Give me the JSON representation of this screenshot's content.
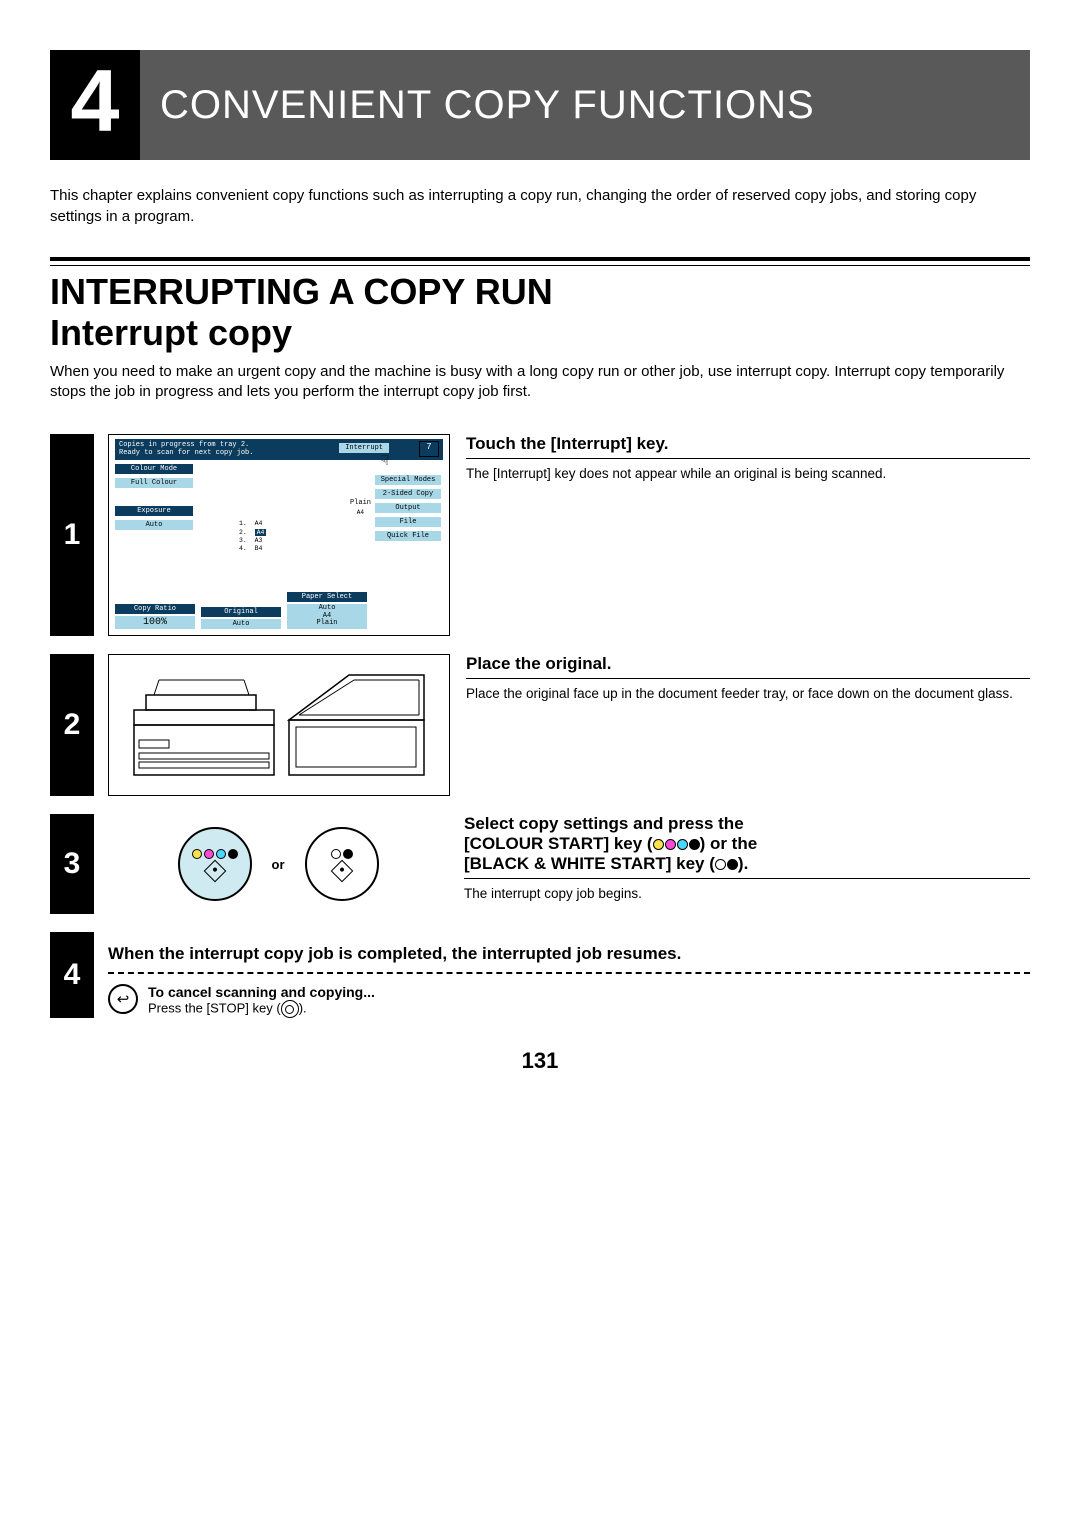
{
  "chapter": {
    "number": "4",
    "title": "CONVENIENT COPY FUNCTIONS"
  },
  "intro": "This chapter explains convenient copy functions such as interrupting a copy run, changing the order of reserved copy jobs, and storing copy settings in a program.",
  "section": {
    "title": "INTERRUPTING A COPY RUN",
    "subtitle": "Interrupt copy",
    "desc": "When you need to make an urgent copy and the machine is busy with a long copy run or other job, use interrupt copy. Interrupt copy temporarily stops the job in progress and lets you perform the interrupt copy job first."
  },
  "steps": {
    "s1": {
      "num": "1",
      "heading": "Touch the [Interrupt] key.",
      "detail": "The [Interrupt] key does not appear while an original is being scanned.",
      "panel": {
        "msg1": "Copies in progress from tray 2.",
        "msg2": "Ready to scan for next copy job.",
        "interrupt": "Interrupt",
        "count": "7",
        "colourMode": "Colour Mode",
        "fullColour": "Full Colour",
        "specialModes": "Special Modes",
        "twoSided": "2-Sided Copy",
        "output": "Output",
        "file": "File",
        "quickFile": "Quick File",
        "plain": "Plain",
        "a4": "A4",
        "exposure": "Exposure",
        "auto": "Auto",
        "copyRatio": "Copy Ratio",
        "ratio": "100%",
        "original": "Original",
        "paperSelect": "Paper Select",
        "autoA4Plain1": "Auto",
        "autoA4Plain2": "A4",
        "autoA4Plain3": "Plain",
        "trays": {
          "t1": "1.",
          "t1v": "A4",
          "t2": "2.",
          "t2v": "A4",
          "t3": "3.",
          "t3v": "A3",
          "t4": "4.",
          "t4v": "B4"
        }
      }
    },
    "s2": {
      "num": "2",
      "heading": "Place the original.",
      "detail": "Place the original face up in the document feeder tray, or face down on the document glass."
    },
    "s3": {
      "num": "3",
      "or": "or",
      "heading_a": "Select copy settings and press the",
      "heading_b": "[COLOUR START] key (",
      "heading_c": ") or the",
      "heading_d": "[BLACK & WHITE START] key (",
      "heading_e": ").",
      "detail": "The interrupt copy job begins."
    },
    "s4": {
      "num": "4",
      "heading": "When the interrupt copy job is completed, the interrupted job resumes.",
      "cancelTitle": "To cancel scanning and copying...",
      "cancelDetail_a": "Press the [STOP] key (",
      "cancelDetail_b": ")."
    }
  },
  "pageNumber": "131"
}
